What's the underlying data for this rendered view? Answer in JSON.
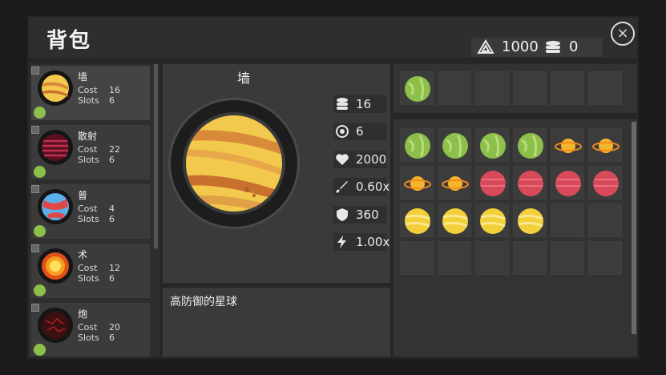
{
  "header": {
    "title": "背包",
    "close_label": "×"
  },
  "currency": {
    "crystals": "1000",
    "coins": "0"
  },
  "planet_list": [
    {
      "name": "墙",
      "cost": "16",
      "slots": "6",
      "type": "yellow-band",
      "selected": true
    },
    {
      "name": "散射",
      "cost": "22",
      "slots": "6",
      "type": "magenta-stripe",
      "selected": false
    },
    {
      "name": "普",
      "cost": "4",
      "slots": "6",
      "type": "red-blue",
      "selected": false
    },
    {
      "name": "术",
      "cost": "12",
      "slots": "6",
      "type": "sun",
      "selected": false
    },
    {
      "name": "炮",
      "cost": "20",
      "slots": "6",
      "type": "lava",
      "selected": false
    }
  ],
  "list_labels": {
    "cost": "Cost",
    "slots": "Slots"
  },
  "detail": {
    "name": "墙",
    "stats": [
      {
        "icon": "coin-stack-icon",
        "value": "16"
      },
      {
        "icon": "target-icon",
        "value": "6"
      },
      {
        "icon": "heart-icon",
        "value": "2000"
      },
      {
        "icon": "sword-icon",
        "value": "0.60x"
      },
      {
        "icon": "shield-icon",
        "value": "360"
      },
      {
        "icon": "lightning-icon",
        "value": "1.00x"
      }
    ],
    "description": "高防御的星球"
  },
  "equipped": [
    "green",
    "",
    "",
    "",
    "",
    ""
  ],
  "inventory": [
    [
      "green",
      "green",
      "green",
      "green",
      "ringed",
      "ringed"
    ],
    [
      "ringed",
      "ringed",
      "red",
      "red",
      "red",
      "red"
    ],
    [
      "yellow",
      "yellow",
      "yellow",
      "yellow",
      "",
      ""
    ],
    [
      "",
      "",
      "",
      "",
      "",
      ""
    ]
  ],
  "colors": {
    "green": "#8dc04a",
    "red": "#d84a5a",
    "yellow": "#f2d03a",
    "ringed": "#f0a020"
  }
}
